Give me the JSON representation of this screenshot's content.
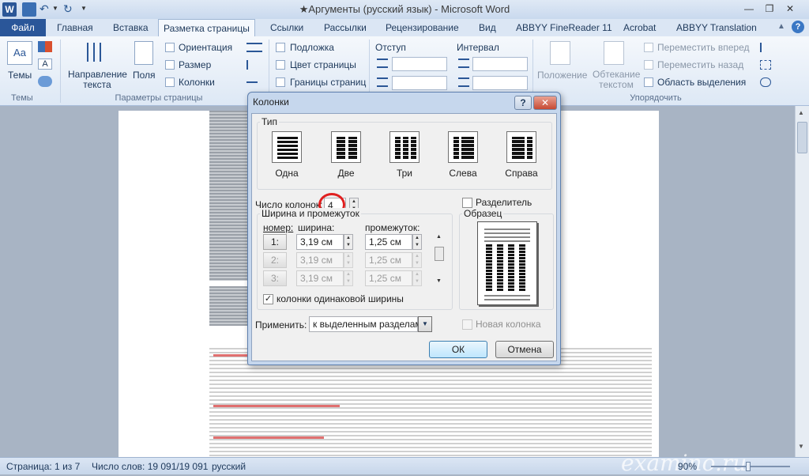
{
  "window": {
    "title": "★Аргументы (русский язык)  -  Microsoft Word",
    "icons": [
      "word-icon",
      "save-icon",
      "undo-icon",
      "redo-icon",
      "customize-icon"
    ],
    "controls": {
      "minimize": "—",
      "restore": "❐",
      "close": "✕"
    }
  },
  "tabs": [
    {
      "label": "Файл",
      "id": "file"
    },
    {
      "label": "Главная",
      "id": "home"
    },
    {
      "label": "Вставка",
      "id": "insert"
    },
    {
      "label": "Разметка страницы",
      "id": "layout"
    },
    {
      "label": "Ссылки",
      "id": "references"
    },
    {
      "label": "Рассылки",
      "id": "mailings"
    },
    {
      "label": "Рецензирование",
      "id": "review"
    },
    {
      "label": "Вид",
      "id": "view"
    },
    {
      "label": "ABBYY FineReader 11",
      "id": "abbyy-fr"
    },
    {
      "label": "Acrobat",
      "id": "acrobat"
    },
    {
      "label": "ABBYY Translation",
      "id": "abbyy-tr"
    }
  ],
  "ribbon": {
    "themes": {
      "label": "Темы",
      "group": "Темы"
    },
    "page_setup": {
      "group": "Параметры страницы",
      "text_direction": "Направление текста",
      "margins": "Поля",
      "orientation": "Ориентация",
      "size": "Размер",
      "columns": "Колонки"
    },
    "page_background": {
      "watermark": "Подложка",
      "page_color": "Цвет страницы",
      "page_borders": "Границы страниц"
    },
    "paragraph": {
      "indent": "Отступ",
      "spacing": "Интервал"
    },
    "arrange": {
      "group": "Упорядочить",
      "position": "Положение",
      "wrap_text": "Обтекание текстом",
      "bring_forward": "Переместить вперед",
      "send_backward": "Переместить назад",
      "selection_pane": "Область выделения"
    }
  },
  "dialog": {
    "title": "Колонки",
    "help": "?",
    "close": "✕",
    "presets_title": "Тип",
    "presets": [
      {
        "label": "Одна",
        "icon": "one-column-icon"
      },
      {
        "label": "Две",
        "icon": "two-columns-icon"
      },
      {
        "label": "Три",
        "icon": "three-columns-icon"
      },
      {
        "label": "Слева",
        "icon": "left-columns-icon"
      },
      {
        "label": "Справа",
        "icon": "right-columns-icon"
      }
    ],
    "num_columns_label": "Число колонок:",
    "num_columns_value": "4",
    "separator_label": "Разделитель",
    "width_group_title": "Ширина и промежуток",
    "col_headers": {
      "number": "номер:",
      "width": "ширина:",
      "spacing": "промежуток:"
    },
    "rows": [
      {
        "num": "1:",
        "width": "3,19 см",
        "spacing": "1,25 см",
        "enabled": true
      },
      {
        "num": "2:",
        "width": "3,19 см",
        "spacing": "1,25 см",
        "enabled": false
      },
      {
        "num": "3:",
        "width": "3,19 см",
        "spacing": "1,25 см",
        "enabled": false
      }
    ],
    "equal_width_label": "колонки одинаковой ширины",
    "sample_title": "Образец",
    "apply_label": "Применить:",
    "apply_value": "к выделенным разделам",
    "new_column_label": "Новая колонка",
    "ok": "ОК",
    "cancel": "Отмена"
  },
  "status": {
    "page": "Страница: 1 из 7",
    "words": "Число слов: 19 091/19 091",
    "language": "русский",
    "zoom": "90%",
    "watermark": "examino.ru"
  },
  "colors": {
    "file_tab": "#2a5699",
    "highlight_circle": "#e02020",
    "ribbon": "#dde8f5"
  }
}
